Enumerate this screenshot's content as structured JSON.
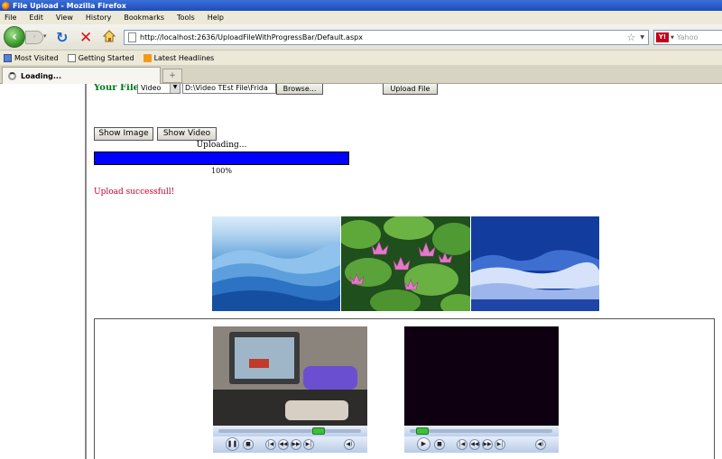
{
  "window": {
    "title": "File Upload - Mozilla Firefox"
  },
  "menu": [
    "File",
    "Edit",
    "View",
    "History",
    "Bookmarks",
    "Tools",
    "Help"
  ],
  "nav": {
    "url": "http://localhost:2636/UploadFileWithProgressBar/Default.aspx",
    "search_placeholder": "Yahoo",
    "search_engine_glyph": "Y!"
  },
  "bookmarks": [
    "Most Visited",
    "Getting Started",
    "Latest Headlines"
  ],
  "tabs": {
    "active_label": "Loading...",
    "new_tab_glyph": "+"
  },
  "form": {
    "label": "Your File",
    "type_value": "Video",
    "file_path": "D:\\Video TEst File\\Frida",
    "browse_label": "Browse...",
    "upload_label": "Upload File",
    "show_image_label": "Show Image",
    "show_video_label": "Show Video",
    "uploading_text": "Uploading...",
    "progress_percent": 100,
    "progress_text": "100%",
    "result_message": "Upload successfull!"
  },
  "colors": {
    "label_green": "#00761a",
    "progress_blue": "#0000ff",
    "message_red": "#c8002a"
  },
  "images": [
    "blue-mountains",
    "water-lilies",
    "frosted-forest"
  ],
  "videos": [
    {
      "name": "driving-simulator-video",
      "seek_position": 0.72
    },
    {
      "name": "dark-video",
      "seek_position": 0.05
    }
  ]
}
